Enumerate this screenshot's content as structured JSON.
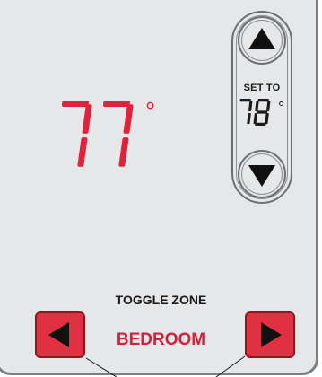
{
  "thermostat": {
    "current_temperature": "77",
    "degree_symbol": "°",
    "set_to_label": "SET TO",
    "set_temperature": "78",
    "toggle_zone_label": "TOGGLE ZONE",
    "zone_name": "BEDROOM"
  },
  "colors": {
    "panel_background": "#e6e7e8",
    "panel_border": "#7c7e82",
    "display_red": "#e2223a",
    "zone_text_red": "#d4203a",
    "arrow_button_fill": "#e03143",
    "arrow_glyph": "#111111",
    "set_temp_text": "#1a1a1a"
  },
  "icons": {
    "increase": "triangle-up-icon",
    "decrease": "triangle-down-icon",
    "previous_zone": "triangle-left-icon",
    "next_zone": "triangle-right-icon"
  }
}
